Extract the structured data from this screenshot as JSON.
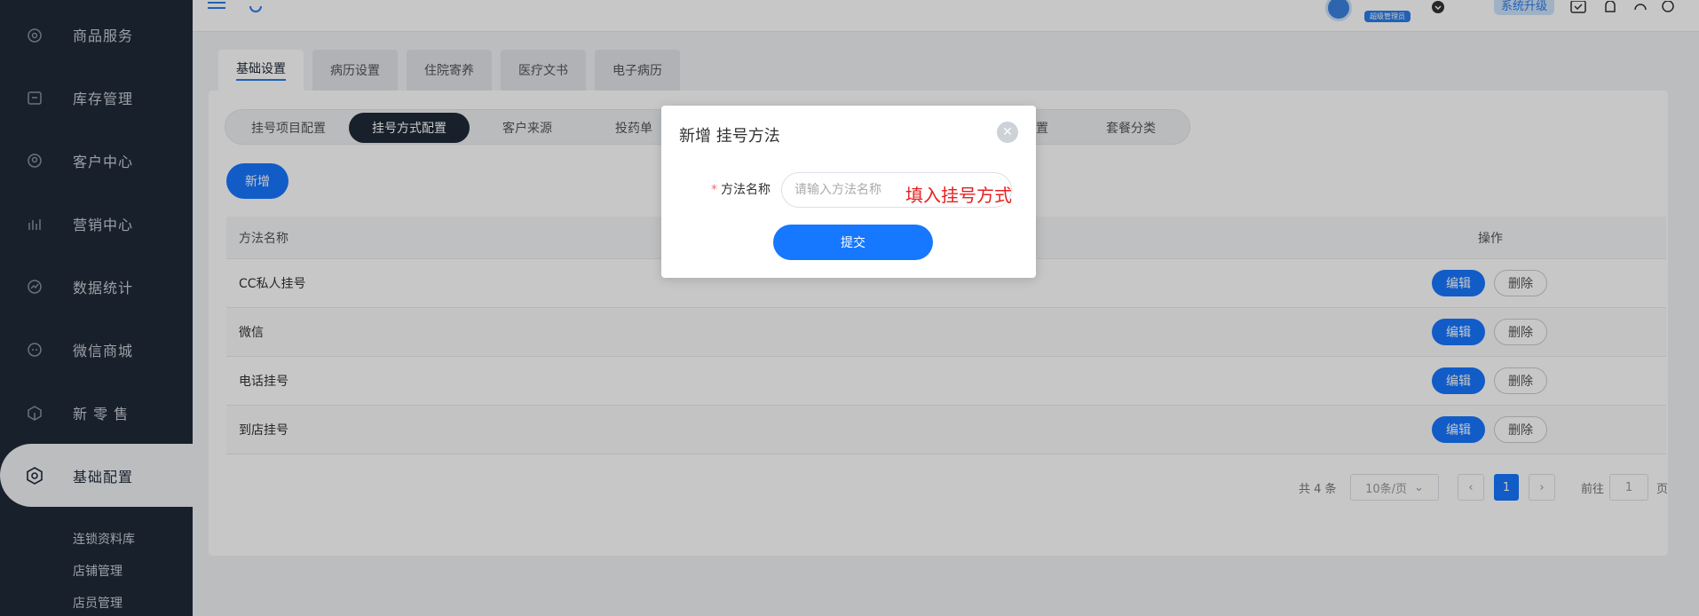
{
  "sidebar": {
    "items": [
      {
        "label": "商品服务",
        "icon": "shopping-bag-icon"
      },
      {
        "label": "库存管理",
        "icon": "inventory-box-icon"
      },
      {
        "label": "客户中心",
        "icon": "customer-icon"
      },
      {
        "label": "营销中心",
        "icon": "marketing-chart-icon"
      },
      {
        "label": "数据统计",
        "icon": "statistics-icon"
      },
      {
        "label": "微信商城",
        "icon": "wechat-icon"
      },
      {
        "label": "新 零 售",
        "icon": "retail-cube-icon"
      },
      {
        "label": "基础配置",
        "icon": "settings-icon"
      }
    ],
    "subitems": [
      "连锁资料库",
      "店铺管理",
      "店员管理"
    ]
  },
  "header": {
    "upgrade_label": "系统升级",
    "admin_badge": "超级管理员"
  },
  "tabs": [
    "基础设置",
    "病历设置",
    "住院寄养",
    "医疗文书",
    "电子病历"
  ],
  "subtabs": [
    "挂号项目配置",
    "挂号方式配置",
    "客户来源",
    "投药单",
    "置",
    "套餐分类"
  ],
  "add_button": "新增",
  "table": {
    "headers": {
      "name": "方法名称",
      "op": "操作"
    },
    "rows": [
      {
        "name": "CC私人挂号"
      },
      {
        "name": "微信"
      },
      {
        "name": "电话挂号"
      },
      {
        "name": "到店挂号"
      }
    ],
    "edit_label": "编辑",
    "delete_label": "删除"
  },
  "pagination": {
    "total": "共 4 条",
    "page_size": "10条/页",
    "current": "1",
    "goto_label": "前往",
    "goto_value": "1",
    "page_unit": "页"
  },
  "modal": {
    "title": "新增 挂号方法",
    "field_label": "方法名称",
    "required_mark": "*",
    "placeholder": "请输入方法名称",
    "annotation": "填入挂号方式",
    "submit_label": "提交"
  },
  "colors": {
    "primary": "#1677ff",
    "sidebar": "#1f2a38",
    "annotation": "#e52020"
  }
}
